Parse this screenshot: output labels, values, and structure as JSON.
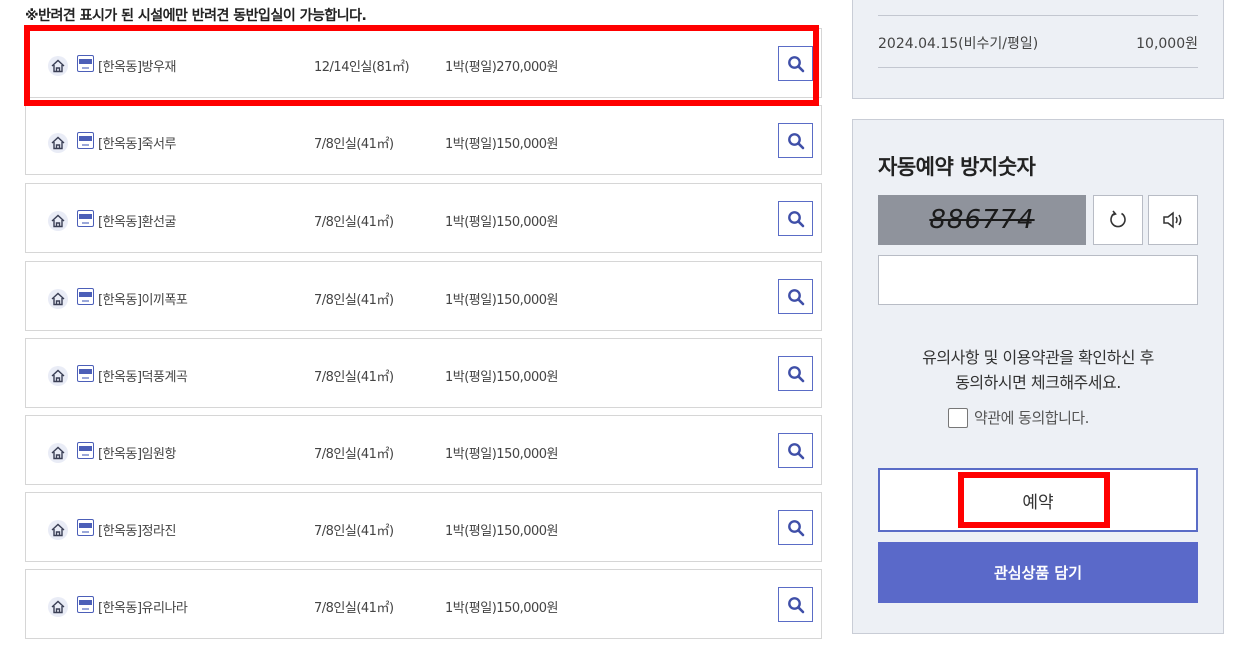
{
  "notice": "※반려견 표시가 된 시설에만 반려견 동반입실이 가능합니다.",
  "rooms": [
    {
      "name": "[한옥동]방우재",
      "capacity": "12/14인실(81㎡)",
      "price": "1박(평일)270,000원"
    },
    {
      "name": "[한옥동]죽서루",
      "capacity": "7/8인실(41㎡)",
      "price": "1박(평일)150,000원"
    },
    {
      "name": "[한옥동]환선굴",
      "capacity": "7/8인실(41㎡)",
      "price": "1박(평일)150,000원"
    },
    {
      "name": "[한옥동]이끼폭포",
      "capacity": "7/8인실(41㎡)",
      "price": "1박(평일)150,000원"
    },
    {
      "name": "[한옥동]덕풍계곡",
      "capacity": "7/8인실(41㎡)",
      "price": "1박(평일)150,000원"
    },
    {
      "name": "[한옥동]임원항",
      "capacity": "7/8인실(41㎡)",
      "price": "1박(평일)150,000원"
    },
    {
      "name": "[한옥동]정라진",
      "capacity": "7/8인실(41㎡)",
      "price": "1박(평일)150,000원"
    },
    {
      "name": "[한옥동]유리나라",
      "capacity": "7/8인실(41㎡)",
      "price": "1박(평일)150,000원"
    }
  ],
  "summary": {
    "date": "2024.04.15(비수기/평일)",
    "amount": "10,000원"
  },
  "captcha": {
    "title": "자동예약 방지숫자",
    "code": "886774",
    "refresh_icon": "refresh-icon",
    "audio_icon": "speaker-icon",
    "input_value": ""
  },
  "terms": {
    "line1": "유의사항 및 이용약관을 확인하신 후",
    "line2": "동의하시면 체크해주세요.",
    "agree_label": "약관에 동의합니다.",
    "agreed": false
  },
  "buttons": {
    "reserve": "예약",
    "wishlist": "관심상품 담기"
  },
  "colors": {
    "accent": "#5a69c9",
    "highlight": "#ff0000",
    "panel_bg": "#edf0f5"
  }
}
